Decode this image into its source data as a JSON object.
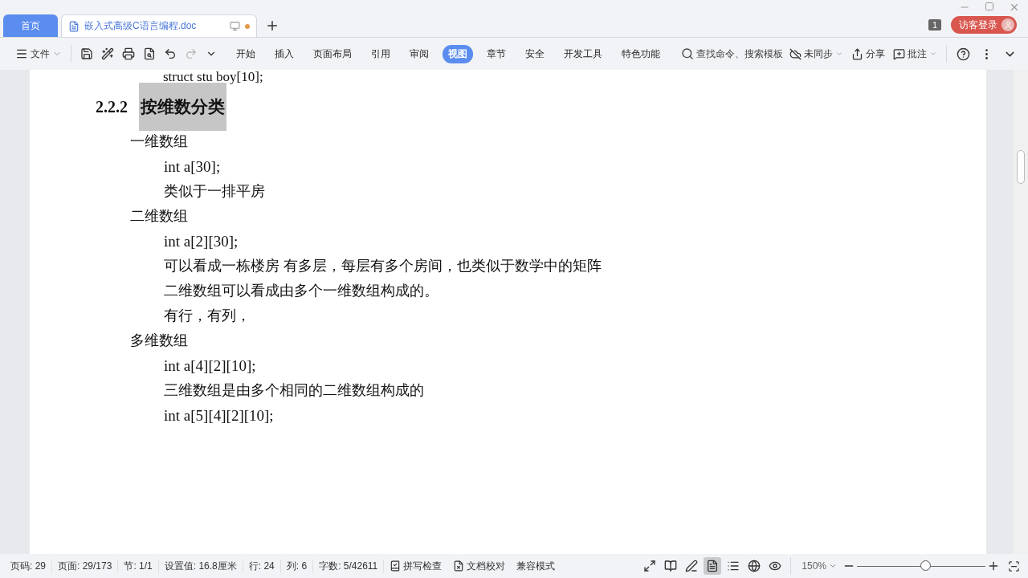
{
  "tabs": [
    {
      "label": "首页",
      "kind": "home",
      "selected": false
    },
    {
      "label": "嵌入式高级C语言编程.doc",
      "kind": "doc",
      "selected": true,
      "unsaved": true
    }
  ],
  "account": {
    "count": "1",
    "login": "访客登录"
  },
  "menu": {
    "file": "文件"
  },
  "ribbon_tabs": [
    {
      "label": "开始",
      "selected": false
    },
    {
      "label": "插入",
      "selected": false
    },
    {
      "label": "页面布局",
      "selected": false
    },
    {
      "label": "引用",
      "selected": false
    },
    {
      "label": "审阅",
      "selected": false
    },
    {
      "label": "视图",
      "selected": true
    },
    {
      "label": "章节",
      "selected": false
    },
    {
      "label": "安全",
      "selected": false
    },
    {
      "label": "开发工具",
      "selected": false
    },
    {
      "label": "特色功能",
      "selected": false
    }
  ],
  "search": {
    "placeholder": "查找命令、搜索模板"
  },
  "right_tools": {
    "sync": "未同步",
    "share": "分享",
    "comment": "批注"
  },
  "document": {
    "cut_line": "struct stu boy[10];",
    "heading": {
      "number": "2.2.2",
      "title": "按维数分类",
      "highlighted": true
    },
    "sections": [
      {
        "label": "一维数组",
        "children": [
          {
            "text": "int a[30];",
            "kind": "code"
          },
          {
            "text": "类似于一排平房",
            "kind": "text"
          }
        ]
      },
      {
        "label": "二维数组",
        "children": [
          {
            "text": "int a[2][30];",
            "kind": "code"
          },
          {
            "text": "可以看成一栋楼房  有多层，每层有多个房间，也类似于数学中的矩阵",
            "kind": "text"
          },
          {
            "text": "二维数组可以看成由多个一维数组构成的。",
            "kind": "text"
          },
          {
            "text": "有行，有列，",
            "kind": "text"
          }
        ]
      },
      {
        "label": "多维数组",
        "children": [
          {
            "text": "int a[4][2][10];",
            "kind": "code"
          },
          {
            "text": "三维数组是由多个相同的二维数组构成的",
            "kind": "text"
          },
          {
            "text": "int a[5][4][2][10];",
            "kind": "code"
          }
        ]
      }
    ]
  },
  "status_bar": {
    "items": [
      "页码: 29",
      "页面: 29/173",
      "节: 1/1",
      "设置值: 16.8厘米",
      "行: 24",
      "列: 6",
      "字数: 5/42611"
    ],
    "spell": "拼写检查",
    "proof": "文档校对",
    "compat": "兼容模式",
    "views": [
      {
        "kind": "fullscreen",
        "selected": false
      },
      {
        "kind": "read",
        "selected": false
      },
      {
        "kind": "edit",
        "selected": false
      },
      {
        "kind": "page",
        "selected": true
      },
      {
        "kind": "outline",
        "selected": false
      },
      {
        "kind": "web",
        "selected": false
      },
      {
        "kind": "eye",
        "selected": false
      }
    ],
    "zoom": "150%",
    "zoom_level": {
      "level": 0.53
    }
  }
}
